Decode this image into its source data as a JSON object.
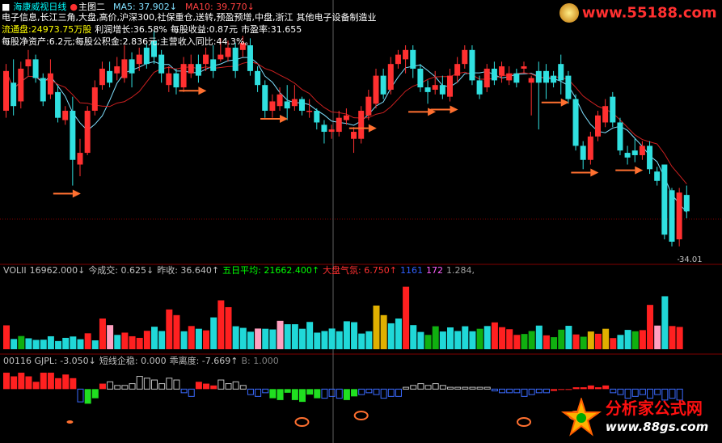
{
  "window": {
    "stock_name": "海康威视",
    "period": "日线",
    "chart_label": "主图二",
    "ma5_label": "MA5: 37.902↓",
    "ma10_label": "MA10: 39.770↓"
  },
  "info": {
    "concepts": "电子信息,长江三角,大盘,高价,沪深300,社保重仓,送转,预盈预增,中盘,浙江",
    "industry": "其他电子设备制造业",
    "line2": [
      {
        "text": "流通盘:24973.75万股",
        "color": "#ffff00"
      },
      {
        "text": "利润增长:36.58%",
        "color": "#ffffff"
      },
      {
        "text": "每股收益:0.87元",
        "color": "#ffffff"
      },
      {
        "text": "市盈率:31.655",
        "color": "#ffffff"
      }
    ],
    "line3": "每股净资产:6.2元;每股公积金:2.836元;主营收入同比:44.3%。"
  },
  "price_label": "34.01",
  "volume_header": [
    {
      "text": "VOLII",
      "color": "#c0c0c0"
    },
    {
      "text": "16962.000↓",
      "color": "#c0c0c0"
    },
    {
      "text": "今成交: 0.625↓",
      "color": "#c0c0c0"
    },
    {
      "text": "昨收: 36.640↑",
      "color": "#c0c0c0"
    },
    {
      "text": "五日平均: 21662.400↑",
      "color": "#00ff00"
    },
    {
      "text": "大盘气氛: 6.750↑",
      "color": "#ff3030"
    },
    {
      "text": "1161",
      "color": "#3060ff"
    },
    {
      "text": "172",
      "color": "#ff60ff"
    },
    {
      "text": "1.284,",
      "color": "#a0a0a0"
    }
  ],
  "indicator_header": [
    {
      "text": "00116 GJPL: -3.050↓",
      "color": "#c0c0c0"
    },
    {
      "text": "短线企稳: 0.000",
      "color": "#c0c0c0"
    },
    {
      "text": "乖离度: -7.669↑",
      "color": "#c0c0c0"
    },
    {
      "text": "B: 1.000",
      "color": "#808080"
    }
  ],
  "watermark": {
    "top_url": "www.55188.com",
    "brand": "分析家公式网",
    "url": "www.88gs.com"
  },
  "colors": {
    "up": "#ff3030",
    "down": "#30e0e0",
    "ma5": "#80e0ff",
    "ma10": "#cc2020",
    "arrow": "#ff7030",
    "grid": "#800000"
  },
  "chart_data": {
    "type": "candlestick",
    "price_ylim": [
      33.3,
      43.5
    ],
    "candles": [
      {
        "o": 39.8,
        "c": 41.5,
        "h": 41.8,
        "l": 39.5
      },
      {
        "o": 41.0,
        "c": 40.0,
        "h": 42.0,
        "l": 39.6
      },
      {
        "o": 40.2,
        "c": 41.6,
        "h": 41.9,
        "l": 39.9
      },
      {
        "o": 41.7,
        "c": 42.0,
        "h": 42.4,
        "l": 41.3
      },
      {
        "o": 42.0,
        "c": 41.2,
        "h": 42.2,
        "l": 41.0
      },
      {
        "o": 41.2,
        "c": 40.2,
        "h": 41.4,
        "l": 40.0
      },
      {
        "o": 40.5,
        "c": 41.4,
        "h": 42.0,
        "l": 40.3
      },
      {
        "o": 40.6,
        "c": 39.5,
        "h": 40.9,
        "l": 39.3
      },
      {
        "o": 39.4,
        "c": 39.8,
        "h": 40.0,
        "l": 39.2
      },
      {
        "o": 39.8,
        "c": 37.7,
        "h": 40.4,
        "l": 36.6
      },
      {
        "o": 37.5,
        "c": 38.0,
        "h": 38.6,
        "l": 37.0
      },
      {
        "o": 38.0,
        "c": 39.8,
        "h": 40.0,
        "l": 37.9
      },
      {
        "o": 39.8,
        "c": 40.8,
        "h": 41.1,
        "l": 39.6
      },
      {
        "o": 40.9,
        "c": 41.6,
        "h": 41.9,
        "l": 40.7
      },
      {
        "o": 41.5,
        "c": 41.0,
        "h": 41.9,
        "l": 40.8
      },
      {
        "o": 41.4,
        "c": 41.7,
        "h": 42.1,
        "l": 41.1
      },
      {
        "o": 41.2,
        "c": 42.0,
        "h": 42.6,
        "l": 41.0
      },
      {
        "o": 42.0,
        "c": 41.4,
        "h": 42.3,
        "l": 40.8
      },
      {
        "o": 41.8,
        "c": 42.2,
        "h": 42.5,
        "l": 41.5
      },
      {
        "o": 42.5,
        "c": 41.8,
        "h": 42.7,
        "l": 41.6
      },
      {
        "o": 42.8,
        "c": 42.1,
        "h": 43.2,
        "l": 41.8
      },
      {
        "o": 42.2,
        "c": 41.4,
        "h": 42.4,
        "l": 41.0
      },
      {
        "o": 40.9,
        "c": 41.4,
        "h": 41.7,
        "l": 40.6
      },
      {
        "o": 41.4,
        "c": 40.8,
        "h": 41.6,
        "l": 40.5
      },
      {
        "o": 40.8,
        "c": 41.8,
        "h": 42.1,
        "l": 40.6
      },
      {
        "o": 41.4,
        "c": 41.8,
        "h": 42.2,
        "l": 41.2
      },
      {
        "o": 41.8,
        "c": 41.3,
        "h": 42.2,
        "l": 41.0
      },
      {
        "o": 41.8,
        "c": 42.2,
        "h": 42.5,
        "l": 41.5
      },
      {
        "o": 42.0,
        "c": 41.5,
        "h": 42.6,
        "l": 41.2
      },
      {
        "o": 42.0,
        "c": 42.2,
        "h": 42.9,
        "l": 41.9
      },
      {
        "o": 42.1,
        "c": 42.5,
        "h": 42.8,
        "l": 41.9
      },
      {
        "o": 42.5,
        "c": 41.5,
        "h": 42.7,
        "l": 41.2
      },
      {
        "o": 42.4,
        "c": 42.7,
        "h": 43.0,
        "l": 42.1
      },
      {
        "o": 42.6,
        "c": 41.5,
        "h": 42.9,
        "l": 41.3
      },
      {
        "o": 41.5,
        "c": 40.9,
        "h": 41.7,
        "l": 40.6
      },
      {
        "o": 40.9,
        "c": 39.8,
        "h": 41.1,
        "l": 39.5
      },
      {
        "o": 39.8,
        "c": 40.2,
        "h": 40.5,
        "l": 39.5
      },
      {
        "o": 40.0,
        "c": 40.5,
        "h": 40.8,
        "l": 39.8
      },
      {
        "o": 40.2,
        "c": 39.9,
        "h": 40.9,
        "l": 39.4
      },
      {
        "o": 40.0,
        "c": 40.3,
        "h": 40.9,
        "l": 39.8
      },
      {
        "o": 40.3,
        "c": 39.8,
        "h": 40.4,
        "l": 39.6
      },
      {
        "o": 39.8,
        "c": 39.8,
        "h": 40.3,
        "l": 39.5
      },
      {
        "o": 39.8,
        "c": 39.3,
        "h": 39.9,
        "l": 39.0
      },
      {
        "o": 39.2,
        "c": 38.9,
        "h": 39.4,
        "l": 38.4
      },
      {
        "o": 38.9,
        "c": 39.0,
        "h": 39.2,
        "l": 38.6
      },
      {
        "o": 38.9,
        "c": 39.5,
        "h": 39.8,
        "l": 38.7
      },
      {
        "o": 39.4,
        "c": 39.6,
        "h": 39.9,
        "l": 39.2
      },
      {
        "o": 38.6,
        "c": 38.9,
        "h": 39.1,
        "l": 38.0
      },
      {
        "o": 38.6,
        "c": 39.8,
        "h": 40.0,
        "l": 38.4
      },
      {
        "o": 39.6,
        "c": 40.4,
        "h": 40.7,
        "l": 39.4
      },
      {
        "o": 40.1,
        "c": 41.3,
        "h": 41.6,
        "l": 39.9
      },
      {
        "o": 41.3,
        "c": 40.5,
        "h": 41.6,
        "l": 40.3
      },
      {
        "o": 40.7,
        "c": 41.8,
        "h": 42.1,
        "l": 40.5
      },
      {
        "o": 41.8,
        "c": 42.2,
        "h": 42.4,
        "l": 41.6
      },
      {
        "o": 42.0,
        "c": 42.4,
        "h": 42.6,
        "l": 41.4
      },
      {
        "o": 42.4,
        "c": 41.6,
        "h": 42.6,
        "l": 41.2
      },
      {
        "o": 41.6,
        "c": 40.8,
        "h": 41.8,
        "l": 40.6
      },
      {
        "o": 40.8,
        "c": 40.6,
        "h": 41.1,
        "l": 40.1
      },
      {
        "o": 40.7,
        "c": 40.9,
        "h": 41.5,
        "l": 40.5
      },
      {
        "o": 40.9,
        "c": 40.5,
        "h": 41.3,
        "l": 40.3
      },
      {
        "o": 40.4,
        "c": 41.3,
        "h": 41.6,
        "l": 40.2
      },
      {
        "o": 41.3,
        "c": 41.8,
        "h": 42.1,
        "l": 41.0
      },
      {
        "o": 41.8,
        "c": 42.4,
        "h": 42.6,
        "l": 41.6
      },
      {
        "o": 42.4,
        "c": 41.1,
        "h": 42.6,
        "l": 40.9
      },
      {
        "o": 41.1,
        "c": 40.5,
        "h": 41.3,
        "l": 40.3
      },
      {
        "o": 40.8,
        "c": 41.6,
        "h": 41.8,
        "l": 40.6
      },
      {
        "o": 41.6,
        "c": 41.1,
        "h": 41.9,
        "l": 40.9
      },
      {
        "o": 41.3,
        "c": 41.7,
        "h": 41.9,
        "l": 41.0
      },
      {
        "o": 41.1,
        "c": 41.4,
        "h": 41.7,
        "l": 40.9
      },
      {
        "o": 41.4,
        "c": 41.0,
        "h": 41.6,
        "l": 40.8
      },
      {
        "o": 41.6,
        "c": 41.7,
        "h": 41.9,
        "l": 41.4
      },
      {
        "o": 41.0,
        "c": 41.2,
        "h": 41.3,
        "l": 39.6
      },
      {
        "o": 41.5,
        "c": 41.0,
        "h": 41.9,
        "l": 39.0
      },
      {
        "o": 41.5,
        "c": 41.0,
        "h": 41.8,
        "l": 40.3
      },
      {
        "o": 41.3,
        "c": 41.0,
        "h": 41.5,
        "l": 40.8
      },
      {
        "o": 41.8,
        "c": 41.1,
        "h": 42.2,
        "l": 40.5
      },
      {
        "o": 41.3,
        "c": 40.3,
        "h": 41.5,
        "l": 40.1
      },
      {
        "o": 40.3,
        "c": 38.3,
        "h": 40.5,
        "l": 38.1
      },
      {
        "o": 38.3,
        "c": 37.7,
        "h": 38.5,
        "l": 37.3
      },
      {
        "o": 37.7,
        "c": 38.7,
        "h": 38.9,
        "l": 37.5
      },
      {
        "o": 38.7,
        "c": 39.6,
        "h": 39.8,
        "l": 38.5
      },
      {
        "o": 39.3,
        "c": 40.0,
        "h": 40.3,
        "l": 39.1
      },
      {
        "o": 40.4,
        "c": 39.3,
        "h": 40.6,
        "l": 39.1
      },
      {
        "o": 39.3,
        "c": 38.1,
        "h": 39.5,
        "l": 37.9
      },
      {
        "o": 38.0,
        "c": 37.8,
        "h": 38.3,
        "l": 37.5
      },
      {
        "o": 38.1,
        "c": 37.9,
        "h": 38.6,
        "l": 37.6
      },
      {
        "o": 37.9,
        "c": 38.3,
        "h": 38.5,
        "l": 37.7
      },
      {
        "o": 38.3,
        "c": 37.3,
        "h": 38.5,
        "l": 37.1
      },
      {
        "o": 37.2,
        "c": 36.8,
        "h": 37.4,
        "l": 36.6
      },
      {
        "o": 37.5,
        "c": 34.5,
        "h": 37.5,
        "l": 34.3
      },
      {
        "o": 36.4,
        "c": 34.2,
        "h": 36.5,
        "l": 34.0
      },
      {
        "o": 34.3,
        "c": 36.3,
        "h": 36.5,
        "l": 34.0
      },
      {
        "o": 36.2,
        "c": 35.5,
        "h": 36.6,
        "l": 35.2
      }
    ],
    "volume": {
      "ylim": [
        0,
        32000
      ],
      "values": [
        10500,
        4500,
        5800,
        4800,
        4100,
        4200,
        5700,
        3600,
        5000,
        5600,
        4400,
        7000,
        3900,
        13500,
        10600,
        6300,
        7300,
        5700,
        5000,
        8100,
        9900,
        8000,
        17500,
        15000,
        7900,
        10200,
        9000,
        8300,
        14000,
        21500,
        18500,
        10100,
        9400,
        7700,
        9100,
        9000,
        8700,
        12500,
        11000,
        11000,
        9000,
        12000,
        7300,
        8000,
        9100,
        7900,
        12300,
        11900,
        6900,
        7900,
        19200,
        15000,
        11400,
        13500,
        27500,
        10600,
        7600,
        6300,
        10100,
        7800,
        9600,
        8000,
        10100,
        7900,
        9000,
        10200,
        11800,
        9700,
        8800,
        6300,
        6700,
        8000,
        10400,
        6100,
        5300,
        8600,
        10300,
        6500,
        5500,
        7800,
        6800,
        9000,
        4900,
        6300,
        8500,
        7900,
        8400,
        19500,
        10400,
        23300,
        10200,
        9800
      ],
      "colors": [
        "r",
        "c",
        "g",
        "c",
        "c",
        "c",
        "c",
        "c",
        "c",
        "c",
        "c",
        "r",
        "c",
        "r",
        "p",
        "c",
        "r",
        "r",
        "r",
        "r",
        "c",
        "c",
        "r",
        "r",
        "c",
        "r",
        "c",
        "r",
        "c",
        "r",
        "r",
        "c",
        "c",
        "c",
        "p",
        "c",
        "c",
        "p",
        "c",
        "c",
        "c",
        "c",
        "c",
        "c",
        "c",
        "c",
        "c",
        "c",
        "c",
        "c",
        "y",
        "y",
        "c",
        "c",
        "r",
        "c",
        "c",
        "g",
        "g",
        "c",
        "c",
        "c",
        "c",
        "c",
        "g",
        "c",
        "r",
        "r",
        "r",
        "r",
        "g",
        "g",
        "c",
        "r",
        "g",
        "g",
        "c",
        "r",
        "g",
        "y",
        "r",
        "y",
        "r",
        "c",
        "c",
        "g",
        "r",
        "r",
        "p",
        "c",
        "r",
        "r"
      ]
    },
    "indicator": {
      "ylim": [
        -2.6,
        1.3
      ],
      "values": [
        0.9,
        0.7,
        0.9,
        0.7,
        0.4,
        0.9,
        0.9,
        0.6,
        0.8,
        0.6,
        -0.7,
        -0.8,
        -0.5,
        0.3,
        0.4,
        0.2,
        0.2,
        0.3,
        0.7,
        0.6,
        0.5,
        0.3,
        0.6,
        0.5,
        -0.2,
        -0.4,
        0.4,
        0.3,
        0.2,
        0.5,
        0.3,
        0.4,
        0.2,
        -0.3,
        -0.4,
        -0.2,
        -0.5,
        -0.6,
        -0.2,
        -0.6,
        -0.7,
        -0.3,
        -0.5,
        -0.5,
        -0.4,
        -0.5,
        -0.6,
        -0.4,
        -0.3,
        -0.2,
        -0.3,
        -0.5,
        -0.4,
        -0.4,
        0.1,
        0.2,
        0.3,
        0.2,
        0.3,
        0.2,
        0.1,
        0.1,
        0.1,
        0.1,
        0.1,
        0.1,
        -0.1,
        -0.2,
        -0.2,
        -0.2,
        -0.4,
        -0.3,
        -0.2,
        -0.2,
        -0.1,
        0.0,
        0.0,
        0.1,
        0.1,
        0.2,
        0.1,
        0.2,
        -0.2,
        -0.3,
        -0.5,
        -0.4,
        -0.3,
        -0.5,
        -0.3,
        -0.6,
        -0.5,
        -0.6,
        -0.6
      ],
      "colors": [
        "r",
        "r",
        "r",
        "r",
        "r",
        "r",
        "r",
        "r",
        "r",
        "r",
        "b",
        "g",
        "g",
        "r",
        "o",
        "o",
        "o",
        "o",
        "o",
        "o",
        "o",
        "o",
        "o",
        "o",
        "b",
        "b",
        "r",
        "r",
        "r",
        "o",
        "o",
        "o",
        "o",
        "b",
        "b",
        "b",
        "g",
        "g",
        "g",
        "g",
        "g",
        "g",
        "g",
        "b",
        "b",
        "b",
        "g",
        "g",
        "b",
        "b",
        "b",
        "b",
        "b",
        "b",
        "o",
        "o",
        "o",
        "o",
        "o",
        "o",
        "o",
        "o",
        "o",
        "o",
        "o",
        "o",
        "b",
        "b",
        "b",
        "b",
        "b",
        "b",
        "b",
        "b",
        "r",
        "r",
        "r",
        "r",
        "r",
        "r",
        "r",
        "r",
        "b",
        "b",
        "b",
        "b",
        "b",
        "b",
        "b",
        "b",
        "b",
        "b"
      ],
      "arrow_markers": [
        9,
        26,
        37,
        49,
        57,
        60,
        75,
        79,
        85
      ],
      "circle_markers": [
        13,
        40,
        48,
        70,
        77
      ]
    }
  }
}
